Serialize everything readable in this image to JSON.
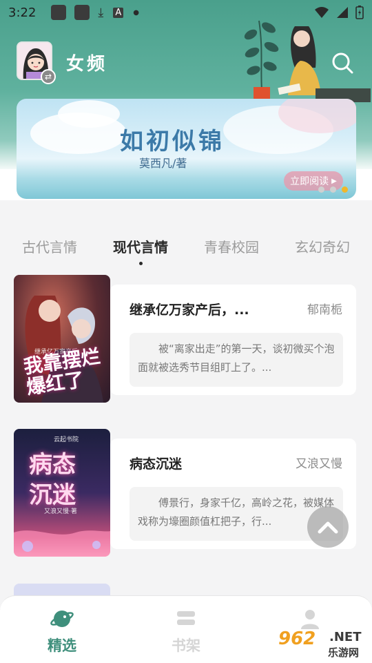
{
  "status_bar": {
    "time": "3:22",
    "icons": [
      "app-square-icon",
      "app-square-icon",
      "download-icon",
      "a-letter-icon",
      "dot-icon",
      "wifi-icon",
      "signal-icon",
      "battery-icon"
    ]
  },
  "header": {
    "channel_title": "女频",
    "avatar_icon": "girl-avatar-icon",
    "switch_icon": "swap-icon",
    "search_icon": "search-icon"
  },
  "banner": {
    "title": "如初似锦",
    "author": "莫西凡/著",
    "cta": "立即阅读",
    "slide_count": 3,
    "active_slide_index": 2,
    "active_dot_color": "#f0b72b"
  },
  "tabs": [
    {
      "label": "古代言情",
      "active": false
    },
    {
      "label": "现代言情",
      "active": true
    },
    {
      "label": "青春校园",
      "active": false
    },
    {
      "label": "玄幻奇幻",
      "active": false
    }
  ],
  "books": [
    {
      "title": "继承亿万家产后，...",
      "author": "郁南栀",
      "blurb": "被“离家出走”的第一天，谈初微买个泡面就被选秀节目组盯上了。...",
      "cover_text": "我靠摆烂爆红了",
      "cover_top_text": "继承亿万家产后"
    },
    {
      "title": "病态沉迷",
      "author": "又浪又慢",
      "blurb": "傅景行，身家千亿，高岭之花，被媒体戏称为壕圈颜值杠把子，行...",
      "cover_text": "病态沉迷",
      "cover_top_text": "云起书院",
      "cover_bottom_text": "又浪又慢·著"
    }
  ],
  "bottom_nav": [
    {
      "label": "精选",
      "icon": "planet-icon",
      "active": true
    },
    {
      "label": "书架",
      "icon": "bookshelf-icon",
      "active": false
    },
    {
      "label": "",
      "icon": "user-icon",
      "active": false
    }
  ],
  "watermark": {
    "number": "962",
    "suffix": ".NET",
    "sub": "乐游网"
  },
  "colors": {
    "accent": "#3f8f7c",
    "header_green": "#4aa08c",
    "inactive": "#d5d5d5"
  }
}
